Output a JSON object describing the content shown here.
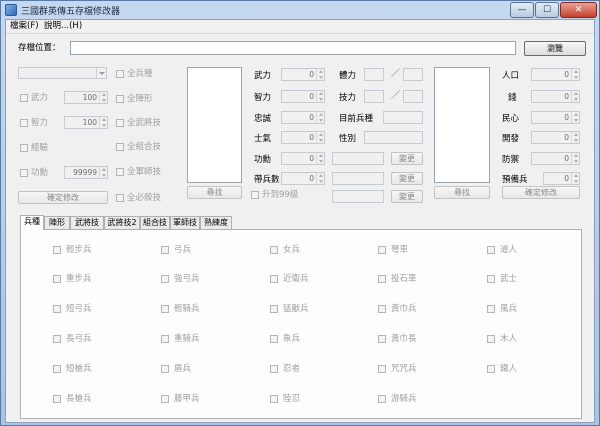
{
  "window": {
    "title": "三國群英傳五存檔修改器",
    "min_glyph": "—",
    "max_glyph": "☐",
    "close_glyph": "✕"
  },
  "menu": {
    "file": "檔案(F)",
    "help": "說明...(H)"
  },
  "save": {
    "label": "存檔位置：",
    "path": "",
    "browse": "瀏覽"
  },
  "left": {
    "combo_value": "",
    "stats": [
      {
        "label": "武力",
        "value": "100"
      },
      {
        "label": "智力",
        "value": "100"
      },
      {
        "label": "經驗",
        "value": ""
      },
      {
        "label": "功勳",
        "value": "99999"
      }
    ],
    "checks": [
      "全兵種",
      "全陣形",
      "全武將技",
      "全組合技",
      "全軍師技",
      "全必殺技"
    ],
    "confirm": "確定修改"
  },
  "mid": {
    "attrs_left": [
      {
        "label": "武力",
        "value": "0"
      },
      {
        "label": "智力",
        "value": "0"
      },
      {
        "label": "忠誠",
        "value": "0"
      },
      {
        "label": "士氣",
        "value": "0"
      },
      {
        "label": "功勳",
        "value": "0"
      },
      {
        "label": "帶兵數",
        "value": "0"
      }
    ],
    "hp_label": "體力",
    "mp_label": "技力",
    "slash": "／",
    "troop_label": "目前兵種",
    "gender_label": "性別",
    "change1": "變更",
    "change2": "變更",
    "change3": "變更",
    "search": "尋找",
    "promote": "升到99級"
  },
  "right": {
    "attrs": [
      {
        "label": "人口",
        "value": "0"
      },
      {
        "label": "錢",
        "value": "0"
      },
      {
        "label": "民心",
        "value": "0"
      },
      {
        "label": "開發",
        "value": "0"
      },
      {
        "label": "防禦",
        "value": "0"
      },
      {
        "label": "預備兵",
        "value": "0"
      }
    ],
    "search": "尋找",
    "confirm": "確定修改"
  },
  "tabs": [
    "兵種",
    "陣形",
    "武將技",
    "武將技2",
    "組合技",
    "軍師技",
    "熟練度"
  ],
  "troops": [
    [
      "輕步兵",
      "弓兵",
      "女兵",
      "弩車",
      "道人"
    ],
    [
      "重步兵",
      "強弓兵",
      "近衛兵",
      "投石車",
      "武士"
    ],
    [
      "短弓兵",
      "輕騎兵",
      "猛獸兵",
      "黃巾兵",
      "風兵"
    ],
    [
      "長弓兵",
      "重騎兵",
      "象兵",
      "黃巾長",
      "木人"
    ],
    [
      "短槍兵",
      "盾兵",
      "忍者",
      "咒咒兵",
      "鐵人"
    ],
    [
      "長槍兵",
      "藤甲兵",
      "陸忍",
      "游騎兵",
      ""
    ]
  ]
}
